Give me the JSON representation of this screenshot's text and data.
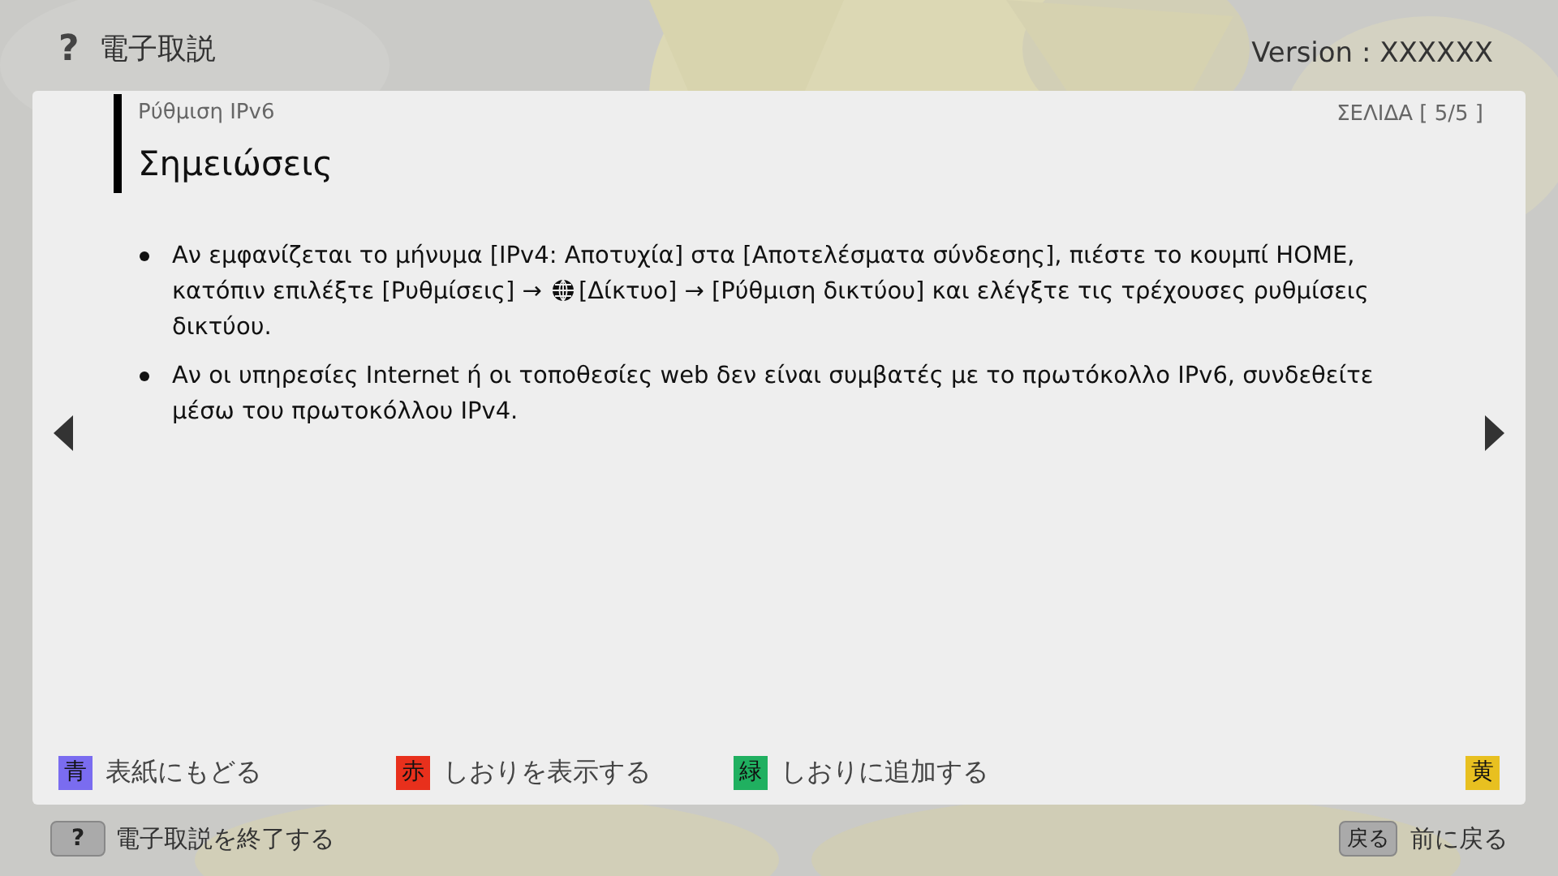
{
  "header": {
    "help_icon_text": "?",
    "title": "電子取説",
    "version": "Version : XXXXXX"
  },
  "card": {
    "section": "Ρύθμιση IPv6",
    "page": "ΣΕΛΙΔΑ [ 5/5 ]",
    "heading": "Σημειώσεις",
    "notes": [
      {
        "before": "Αν εμφανίζεται το μήνυμα [IPv4: Αποτυχία] στα [Αποτελέσματα σύνδεσης], πιέστε το κουμπί HOME, κατόπιν επιλέξτε [Ρυθμίσεις] → ",
        "after": "[Δίκτυο] → [Ρύθμιση δικτύου] και ελέγξτε τις τρέχουσες ρυθμίσεις δικτύου.",
        "kind": "with_icon"
      },
      {
        "before": "Αν οι υπηρεσίες Internet ή οι τοποθεσίες web δεν είναι συμβατές με το πρωτόκολλο IPv6, συνδεθείτε μέσω του πρωτοκόλλου IPv4.",
        "kind": "text"
      }
    ],
    "color_keys": [
      {
        "key": "青",
        "label": "表紙にもどる",
        "color": "#7a6cf0"
      },
      {
        "key": "赤",
        "label": "しおりを表示する",
        "color": "#e8301c"
      },
      {
        "key": "緑",
        "label": "しおりに追加する",
        "color": "#20b060"
      },
      {
        "key": "黄",
        "color": "#e8c020"
      }
    ]
  },
  "footer": {
    "exit_key": "?",
    "exit_label": "電子取説を終了する",
    "back_key": "戻る",
    "back_label": "前に戻る"
  }
}
